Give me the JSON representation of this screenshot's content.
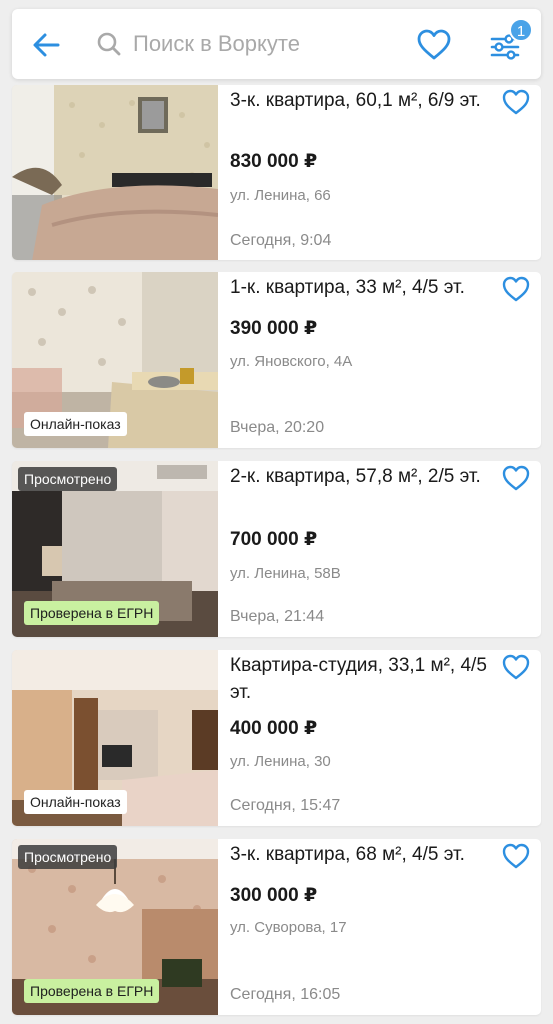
{
  "header": {
    "search_placeholder": "Поиск в Воркуте",
    "filter_badge": "1",
    "accent_color": "#2d8fe0"
  },
  "listings": [
    {
      "title": "3-к. квартира, 60,1 м², 6/9 эт.",
      "price": "830 000 ₽",
      "address": "ул. Ленина, 66",
      "date": "Сегодня, 9:04",
      "chip_online": "",
      "chip_egrn": "",
      "chip_seen": ""
    },
    {
      "title": "1-к. квартира, 33 м², 4/5 эт.",
      "price": "390 000 ₽",
      "address": "ул. Яновского, 4А",
      "date": "Вчера, 20:20",
      "chip_online": "Онлайн-показ",
      "chip_egrn": "",
      "chip_seen": ""
    },
    {
      "title": "2-к. квартира, 57,8 м², 2/5 эт.",
      "price": "700 000 ₽",
      "address": "ул. Ленина, 58В",
      "date": "Вчера, 21:44",
      "chip_online": "",
      "chip_egrn": "Проверена в ЕГРН",
      "chip_seen": "Просмотрено"
    },
    {
      "title": "Квартира-студия, 33,1 м², 4/5 эт.",
      "price": "400 000 ₽",
      "address": "ул. Ленина, 30",
      "date": "Сегодня, 15:47",
      "chip_online": "Онлайн-показ",
      "chip_egrn": "",
      "chip_seen": ""
    },
    {
      "title": "3-к. квартира, 68 м², 4/5 эт.",
      "price": "300 000 ₽",
      "address": "ул. Суворова, 17",
      "date": "Сегодня, 16:05",
      "chip_online": "",
      "chip_egrn": "Проверена в ЕГРН",
      "chip_seen": "Просмотрено"
    }
  ]
}
